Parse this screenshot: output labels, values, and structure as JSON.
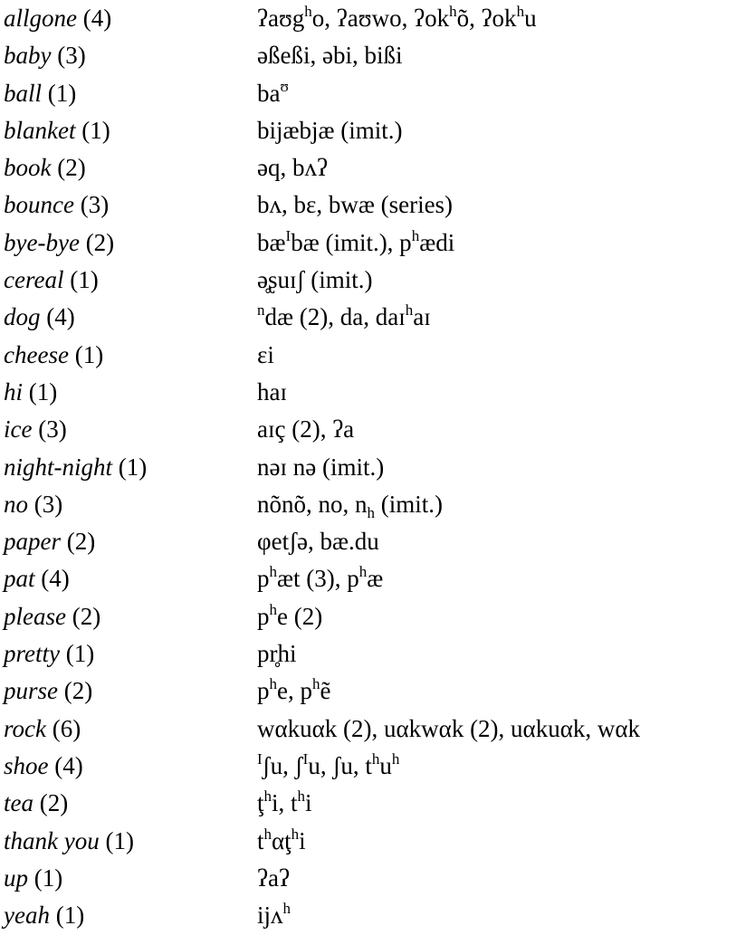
{
  "entries": [
    {
      "word": "allgone",
      "count": "(4)",
      "forms": [
        [
          "ʔaʊg",
          ""
        ],
        [
          "h",
          "sup"
        ],
        [
          "o, ʔaʊwo, ʔok",
          ""
        ],
        [
          "h",
          "sup"
        ],
        [
          "õ, ʔok",
          ""
        ],
        [
          "h",
          "sup"
        ],
        [
          "u",
          ""
        ]
      ]
    },
    {
      "word": "baby",
      "count": "(3)",
      "forms": [
        [
          "əßeßi, əbi, bißi",
          ""
        ]
      ]
    },
    {
      "word": "ball",
      "count": "(1)",
      "forms": [
        [
          "ba",
          ""
        ],
        [
          "ʊ",
          "sup"
        ]
      ]
    },
    {
      "word": "blanket",
      "count": "(1)",
      "forms": [
        [
          "bijæbjæ (imit.)",
          ""
        ]
      ]
    },
    {
      "word": "book",
      "count": "(2)",
      "forms": [
        [
          "əq, bʌʔ",
          ""
        ]
      ]
    },
    {
      "word": "bounce",
      "count": "(3)",
      "forms": [
        [
          "bʌ, bɛ, bwæ (series)",
          ""
        ]
      ]
    },
    {
      "word": "bye-bye",
      "count": "(2)",
      "forms": [
        [
          "bæ",
          ""
        ],
        [
          "I",
          "sup"
        ],
        [
          "bæ (imit.), p",
          ""
        ],
        [
          "h",
          "sup"
        ],
        [
          "ædi",
          ""
        ]
      ]
    },
    {
      "word": "cereal",
      "count": "(1)",
      "forms": [
        [
          "ə̥ʂuɪʃ (imit.)",
          ""
        ]
      ]
    },
    {
      "word": "dog",
      "count": "(4)",
      "forms": [
        [
          "n",
          "sup"
        ],
        [
          "dæ (2), da, daɪ",
          ""
        ],
        [
          "h",
          "sup"
        ],
        [
          "aɪ",
          ""
        ]
      ]
    },
    {
      "word": "cheese",
      "count": "(1)",
      "forms": [
        [
          "ɛi",
          ""
        ]
      ]
    },
    {
      "word": "hi",
      "count": "(1)",
      "forms": [
        [
          "haɪ",
          ""
        ]
      ]
    },
    {
      "word": "ice",
      "count": "(3)",
      "forms": [
        [
          "aɪç (2), ʔa",
          ""
        ]
      ]
    },
    {
      "word": "night-night",
      "count": "(1)",
      "forms": [
        [
          "nəɪ nə (imit.)",
          ""
        ]
      ]
    },
    {
      "word": "no",
      "count": "(3)",
      "forms": [
        [
          "nõnõ, no, n",
          ""
        ],
        [
          "h",
          "sub"
        ],
        [
          " (imit.)",
          ""
        ]
      ]
    },
    {
      "word": "paper",
      "count": "(2)",
      "forms": [
        [
          "φetʃə, bæ.du",
          ""
        ]
      ]
    },
    {
      "word": "pat",
      "count": "(4)",
      "forms": [
        [
          "p",
          ""
        ],
        [
          "h",
          "sup"
        ],
        [
          "æt (3), p",
          ""
        ],
        [
          "h",
          "sup"
        ],
        [
          "æ",
          ""
        ]
      ]
    },
    {
      "word": "please",
      "count": "(2)",
      "forms": [
        [
          "p",
          ""
        ],
        [
          "h",
          "sup"
        ],
        [
          "e (2)",
          ""
        ]
      ]
    },
    {
      "word": "pretty",
      "count": "(1)",
      "forms": [
        [
          "pr̥hi",
          ""
        ]
      ]
    },
    {
      "word": "purse",
      "count": "(2)",
      "forms": [
        [
          "p",
          ""
        ],
        [
          "h",
          "sup"
        ],
        [
          "e, p",
          ""
        ],
        [
          "h",
          "sup"
        ],
        [
          "ẽ",
          ""
        ]
      ]
    },
    {
      "word": "rock",
      "count": "(6)",
      "forms": [
        [
          "wαkuαk (2), uαkwαk (2), uαkuαk, wαk",
          ""
        ]
      ]
    },
    {
      "word": "shoe",
      "count": "(4)",
      "forms": [
        [
          "I",
          "sup"
        ],
        [
          "ʃu, ʃ",
          ""
        ],
        [
          "I",
          "sup"
        ],
        [
          "u, ʃu, t",
          ""
        ],
        [
          "h",
          "sup"
        ],
        [
          "u",
          ""
        ],
        [
          "h",
          "sup"
        ]
      ]
    },
    {
      "word": "tea",
      "count": "(2)",
      "forms": [
        [
          "ţ",
          ""
        ],
        [
          "h",
          "sup"
        ],
        [
          "i, t",
          ""
        ],
        [
          "h",
          "sup"
        ],
        [
          "i",
          ""
        ]
      ]
    },
    {
      "word": "thank you",
      "count": "(1)",
      "forms": [
        [
          "t",
          ""
        ],
        [
          "h",
          "sup"
        ],
        [
          "αţ",
          ""
        ],
        [
          "h",
          "sup"
        ],
        [
          "i",
          ""
        ]
      ]
    },
    {
      "word": "up",
      "count": "(1)",
      "forms": [
        [
          "ʔaʔ",
          ""
        ]
      ]
    },
    {
      "word": "yeah",
      "count": "(1)",
      "forms": [
        [
          "ijʌ",
          ""
        ],
        [
          "h",
          "sup"
        ]
      ]
    }
  ]
}
